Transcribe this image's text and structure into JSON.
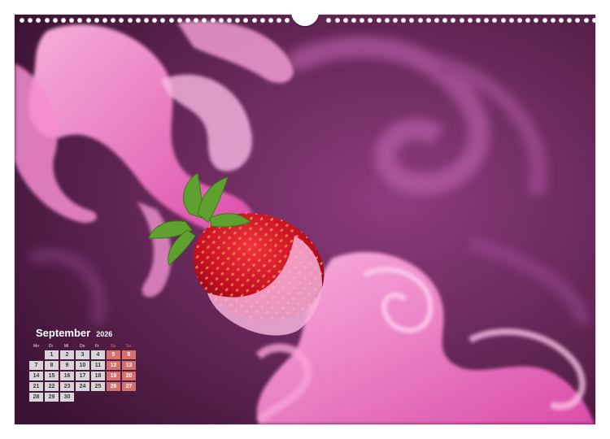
{
  "calendar": {
    "month": "September",
    "year": "2026",
    "weekdays": [
      "Mo",
      "Di",
      "Mi",
      "Do",
      "Fr",
      "Sa",
      "So"
    ],
    "days": [
      [
        "",
        "1",
        "2",
        "3",
        "4",
        "5",
        "6"
      ],
      [
        "7",
        "8",
        "9",
        "10",
        "11",
        "12",
        "13"
      ],
      [
        "14",
        "15",
        "16",
        "17",
        "18",
        "19",
        "20"
      ],
      [
        "21",
        "22",
        "23",
        "24",
        "25",
        "26",
        "27"
      ],
      [
        "28",
        "29",
        "30",
        "",
        "",
        "",
        ""
      ]
    ]
  },
  "colors": {
    "background_dark": "#5a1f4a",
    "smoke_pink": "#f27ac4",
    "strawberry_red": "#d3122a",
    "leaf_green": "#5ea12f",
    "weekend_cell": "#d6706b"
  }
}
